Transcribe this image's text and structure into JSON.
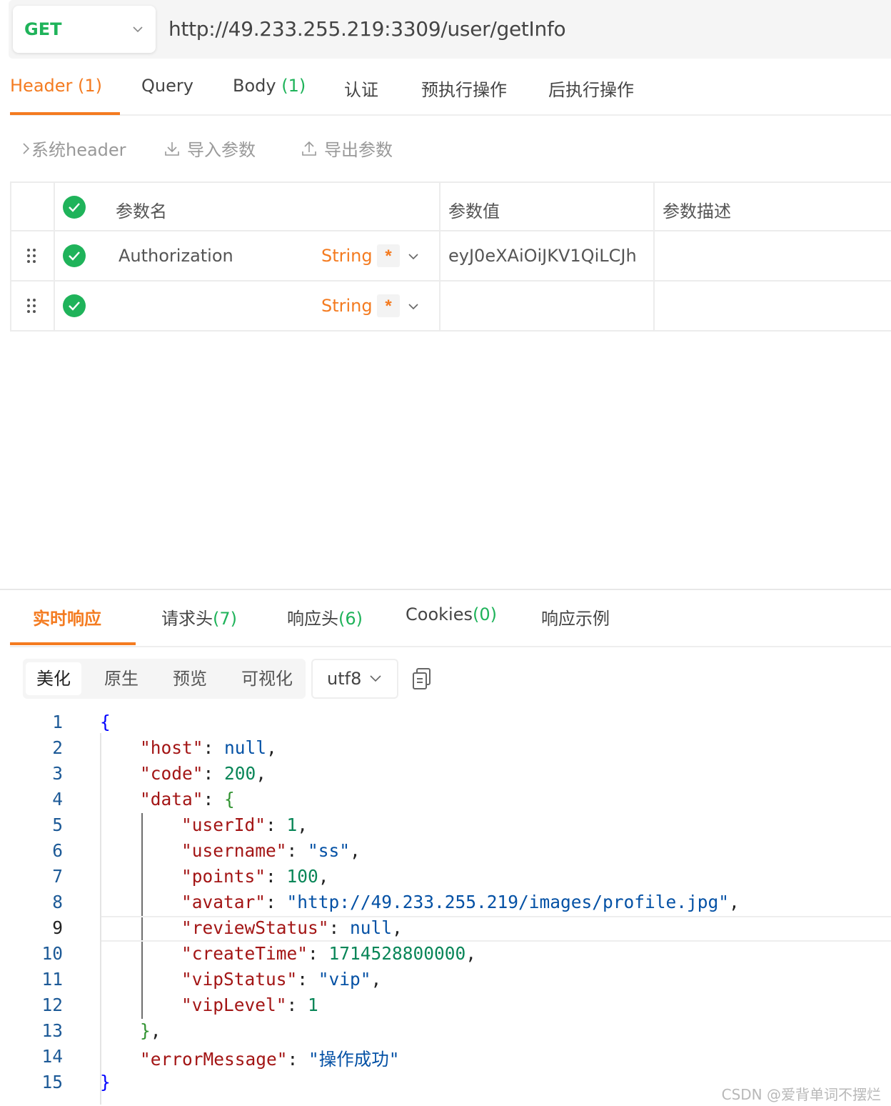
{
  "request": {
    "method": "GET",
    "url": "http://49.233.255.219:3309/user/getInfo"
  },
  "request_tabs": [
    {
      "label": "Header",
      "count": "(1)"
    },
    {
      "label": "Query",
      "count": ""
    },
    {
      "label": "Body",
      "count": "(1)"
    },
    {
      "label": "认证",
      "count": ""
    },
    {
      "label": "预执行操作",
      "count": ""
    },
    {
      "label": "后执行操作",
      "count": ""
    }
  ],
  "toolbar": {
    "system_header": "系统header",
    "import": "导入参数",
    "export": "导出参数"
  },
  "header_table": {
    "col_name": "参数名",
    "col_value": "参数值",
    "col_desc": "参数描述",
    "rows": [
      {
        "name": "Authorization",
        "type": "String",
        "required": "*",
        "value": "eyJ0eXAiOiJKV1QiLCJh",
        "desc": ""
      },
      {
        "name": "",
        "type": "String",
        "required": "*",
        "value": "",
        "desc": ""
      }
    ]
  },
  "response_tabs": [
    {
      "label": "实时响应",
      "count": ""
    },
    {
      "label": "请求头",
      "count": "(7)"
    },
    {
      "label": "响应头",
      "count": "(6)"
    },
    {
      "label": "Cookies",
      "count": "(0)"
    },
    {
      "label": "响应示例",
      "count": ""
    }
  ],
  "view_modes": [
    "美化",
    "原生",
    "预览",
    "可视化"
  ],
  "encoding": "utf8",
  "code": {
    "current_line": 9,
    "lines": [
      "1",
      "2",
      "3",
      "4",
      "5",
      "6",
      "7",
      "8",
      "9",
      "10",
      "11",
      "12",
      "13",
      "14",
      "15"
    ],
    "json": {
      "host": "null",
      "code": "200",
      "userId": "1",
      "username": "\"ss\"",
      "points": "100",
      "avatar": "\"http://49.233.255.219/images/profile.jpg\"",
      "reviewStatus": "null",
      "createTime": "1714528800000",
      "vipStatus": "\"vip\"",
      "vipLevel": "1",
      "errorMessage": "\"操作成功\""
    }
  },
  "watermark": "CSDN @爱背单词不摆烂",
  "colors": {
    "accent_orange": "#f47b20",
    "green": "#1fb35a",
    "json_key": "#a31515",
    "json_string": "#0451a5",
    "json_number": "#098658"
  }
}
